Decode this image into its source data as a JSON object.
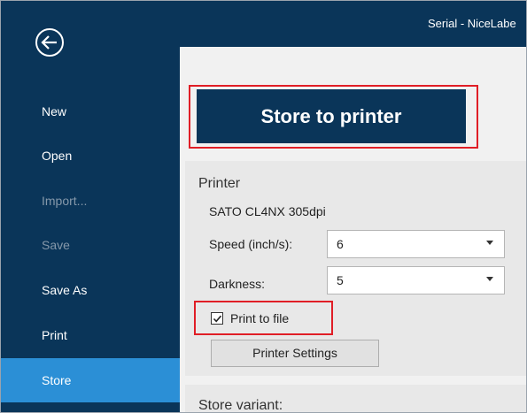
{
  "window": {
    "title": "Serial - NiceLabe"
  },
  "sidebar": {
    "items": [
      {
        "label": "New"
      },
      {
        "label": "Open"
      },
      {
        "label": "Import..."
      },
      {
        "label": "Save"
      },
      {
        "label": "Save As"
      },
      {
        "label": "Print"
      },
      {
        "label": "Store"
      }
    ]
  },
  "main": {
    "store_button_label": "Store to printer",
    "printer_section_title": "Printer",
    "printer_name": "SATO CL4NX 305dpi",
    "speed_label": "Speed (inch/s):",
    "speed_value": "6",
    "darkness_label": "Darkness:",
    "darkness_value": "5",
    "print_to_file_label": "Print to file",
    "print_to_file_checked": true,
    "printer_settings_label": "Printer Settings",
    "variant_section_title": "Store variant:"
  },
  "colors": {
    "sidebar_bg": "#0a3559",
    "selected_bg": "#2b8fd6",
    "highlight": "#e01e26"
  },
  "icons": {
    "back": "back-arrow-circle-icon",
    "check": "checkmark-icon",
    "dropdown": "chevron-down-icon"
  }
}
